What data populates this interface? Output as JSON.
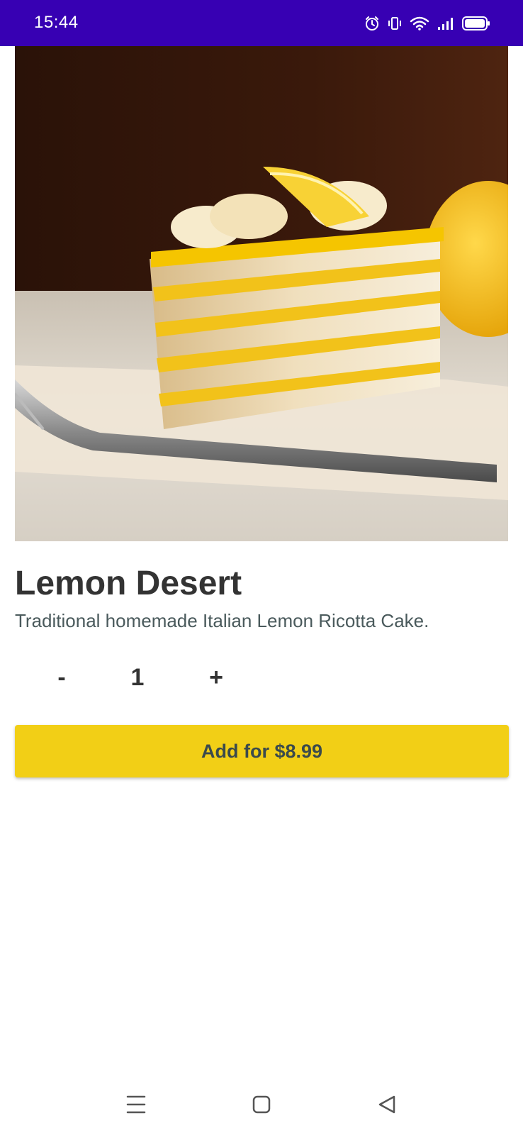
{
  "status_bar": {
    "time": "15:44",
    "background": "#3700b3",
    "icons": [
      "alarm-icon",
      "vibrate-icon",
      "wifi-icon",
      "signal-icon",
      "battery-icon"
    ]
  },
  "product": {
    "image": "lemon-cake-slice-photo",
    "title": "Lemon Desert",
    "description": "Traditional homemade Italian Lemon Ricotta Cake."
  },
  "quantity": {
    "decrement_label": "-",
    "value": "1",
    "increment_label": "+"
  },
  "cta": {
    "label": "Add for $8.99",
    "color": "#f2cf16"
  },
  "nav_bar": {
    "icons": [
      "menu-icon",
      "home-icon",
      "back-icon"
    ]
  }
}
